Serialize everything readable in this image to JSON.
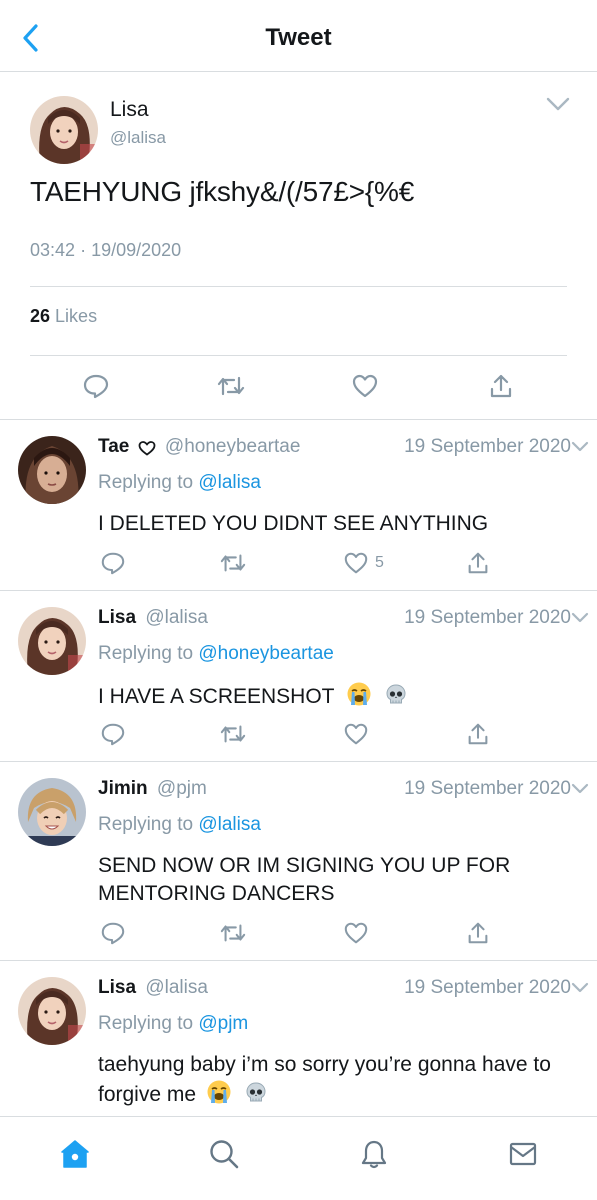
{
  "header": {
    "title": "Tweet"
  },
  "main_tweet": {
    "name": "Lisa",
    "handle": "@lalisa",
    "text": "TAEHYUNG jfkshy&/(/57£>{%€",
    "time": "03:42",
    "date": "19/09/2020",
    "likes_count": "26",
    "likes_label": "Likes"
  },
  "replies": [
    {
      "name": "Tae",
      "handle": "@honeybeartae",
      "date": "19 September 2020",
      "replying_prefix": "Replying to",
      "replying_to": "@lalisa",
      "text": "I DELETED YOU DIDNT SEE ANYTHING",
      "like_count": "5"
    },
    {
      "name": "Lisa",
      "handle": "@lalisa",
      "date": "19 September 2020",
      "replying_prefix": "Replying to",
      "replying_to": "@honeybeartae",
      "text": "I HAVE A SCREENSHOT",
      "emojis": [
        "loudly-crying-face",
        "skull"
      ]
    },
    {
      "name": "Jimin",
      "handle": "@pjm",
      "date": "19 September 2020",
      "replying_prefix": "Replying to",
      "replying_to": "@lalisa",
      "text": "SEND NOW OR IM SIGNING YOU UP FOR MENTORING DANCERS"
    },
    {
      "name": "Lisa",
      "handle": "@lalisa",
      "date": "19 September 2020",
      "replying_prefix": "Replying to",
      "replying_to": "@pjm",
      "text": "taehyung baby i’m so sorry you’re gonna have to forgive me",
      "emojis": [
        "loudly-crying-face",
        "skull"
      ]
    }
  ],
  "tabbar": {
    "items": [
      "home-icon",
      "search-icon",
      "notifications-icon",
      "messages-icon"
    ],
    "active": "home-icon"
  },
  "colors": {
    "accent": "#1da1f2",
    "mention": "#1b95e0",
    "muted": "#8899a6",
    "text": "#14171a",
    "divider": "#d9dde0"
  }
}
